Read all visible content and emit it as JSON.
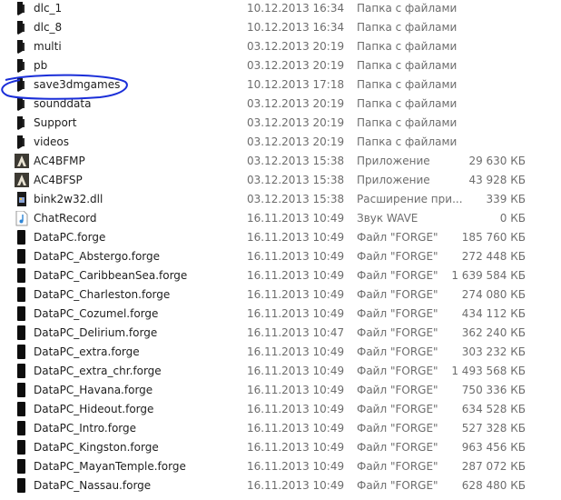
{
  "files": [
    {
      "name": "dlc_1",
      "date": "10.12.2013 16:34",
      "type": "Папка с файлами",
      "size": "",
      "icon": "folder-icon"
    },
    {
      "name": "dlc_8",
      "date": "10.12.2013 16:34",
      "type": "Папка с файлами",
      "size": "",
      "icon": "folder-icon"
    },
    {
      "name": "multi",
      "date": "03.12.2013 20:19",
      "type": "Папка с файлами",
      "size": "",
      "icon": "folder-icon"
    },
    {
      "name": "pb",
      "date": "03.12.2013 20:19",
      "type": "Папка с файлами",
      "size": "",
      "icon": "folder-icon"
    },
    {
      "name": "save3dmgames",
      "date": "10.12.2013 17:18",
      "type": "Папка с файлами",
      "size": "",
      "icon": "folder-icon"
    },
    {
      "name": "sounddata",
      "date": "03.12.2013 20:19",
      "type": "Папка с файлами",
      "size": "",
      "icon": "folder-icon"
    },
    {
      "name": "Support",
      "date": "03.12.2013 20:19",
      "type": "Папка с файлами",
      "size": "",
      "icon": "folder-icon"
    },
    {
      "name": "videos",
      "date": "03.12.2013 20:19",
      "type": "Папка с файлами",
      "size": "",
      "icon": "folder-icon"
    },
    {
      "name": "AC4BFMP",
      "date": "03.12.2013 15:38",
      "type": "Приложение",
      "size": "29 630 КБ",
      "icon": "app-icon"
    },
    {
      "name": "AC4BFSP",
      "date": "03.12.2013 15:38",
      "type": "Приложение",
      "size": "43 928 КБ",
      "icon": "app-icon"
    },
    {
      "name": "bink2w32.dll",
      "date": "03.12.2013 15:38",
      "type": "Расширение при...",
      "size": "339 КБ",
      "icon": "dll-icon"
    },
    {
      "name": "ChatRecord",
      "date": "16.11.2013 10:49",
      "type": "Звук WAVE",
      "size": "0 КБ",
      "icon": "audio-file-icon"
    },
    {
      "name": "DataPC.forge",
      "date": "16.11.2013 10:49",
      "type": "Файл \"FORGE\"",
      "size": "185 760 КБ",
      "icon": "file-icon"
    },
    {
      "name": "DataPC_Abstergo.forge",
      "date": "16.11.2013 10:49",
      "type": "Файл \"FORGE\"",
      "size": "272 448 КБ",
      "icon": "file-icon"
    },
    {
      "name": "DataPC_CaribbeanSea.forge",
      "date": "16.11.2013 10:49",
      "type": "Файл \"FORGE\"",
      "size": "1 639 584 КБ",
      "icon": "file-icon"
    },
    {
      "name": "DataPC_Charleston.forge",
      "date": "16.11.2013 10:49",
      "type": "Файл \"FORGE\"",
      "size": "274 080 КБ",
      "icon": "file-icon"
    },
    {
      "name": "DataPC_Cozumel.forge",
      "date": "16.11.2013 10:49",
      "type": "Файл \"FORGE\"",
      "size": "434 112 КБ",
      "icon": "file-icon"
    },
    {
      "name": "DataPC_Delirium.forge",
      "date": "16.11.2013 10:47",
      "type": "Файл \"FORGE\"",
      "size": "362 240 КБ",
      "icon": "file-icon"
    },
    {
      "name": "DataPC_extra.forge",
      "date": "16.11.2013 10:49",
      "type": "Файл \"FORGE\"",
      "size": "303 232 КБ",
      "icon": "file-icon"
    },
    {
      "name": "DataPC_extra_chr.forge",
      "date": "16.11.2013 10:49",
      "type": "Файл \"FORGE\"",
      "size": "1 493 568 КБ",
      "icon": "file-icon"
    },
    {
      "name": "DataPC_Havana.forge",
      "date": "16.11.2013 10:49",
      "type": "Файл \"FORGE\"",
      "size": "750 336 КБ",
      "icon": "file-icon"
    },
    {
      "name": "DataPC_Hideout.forge",
      "date": "16.11.2013 10:49",
      "type": "Файл \"FORGE\"",
      "size": "634 528 КБ",
      "icon": "file-icon"
    },
    {
      "name": "DataPC_Intro.forge",
      "date": "16.11.2013 10:49",
      "type": "Файл \"FORGE\"",
      "size": "527 328 КБ",
      "icon": "file-icon"
    },
    {
      "name": "DataPC_Kingston.forge",
      "date": "16.11.2013 10:49",
      "type": "Файл \"FORGE\"",
      "size": "963 456 КБ",
      "icon": "file-icon"
    },
    {
      "name": "DataPC_MayanTemple.forge",
      "date": "16.11.2013 10:49",
      "type": "Файл \"FORGE\"",
      "size": "287 072 КБ",
      "icon": "file-icon"
    },
    {
      "name": "DataPC_Nassau.forge",
      "date": "16.11.2013 10:49",
      "type": "Файл \"FORGE\"",
      "size": "628 480 КБ",
      "icon": "file-icon"
    }
  ],
  "colors": {
    "annotation": "#1a2ed8",
    "text": "#1e1e1e",
    "secondary_text": "#6d6d6d",
    "background": "#ffffff"
  }
}
